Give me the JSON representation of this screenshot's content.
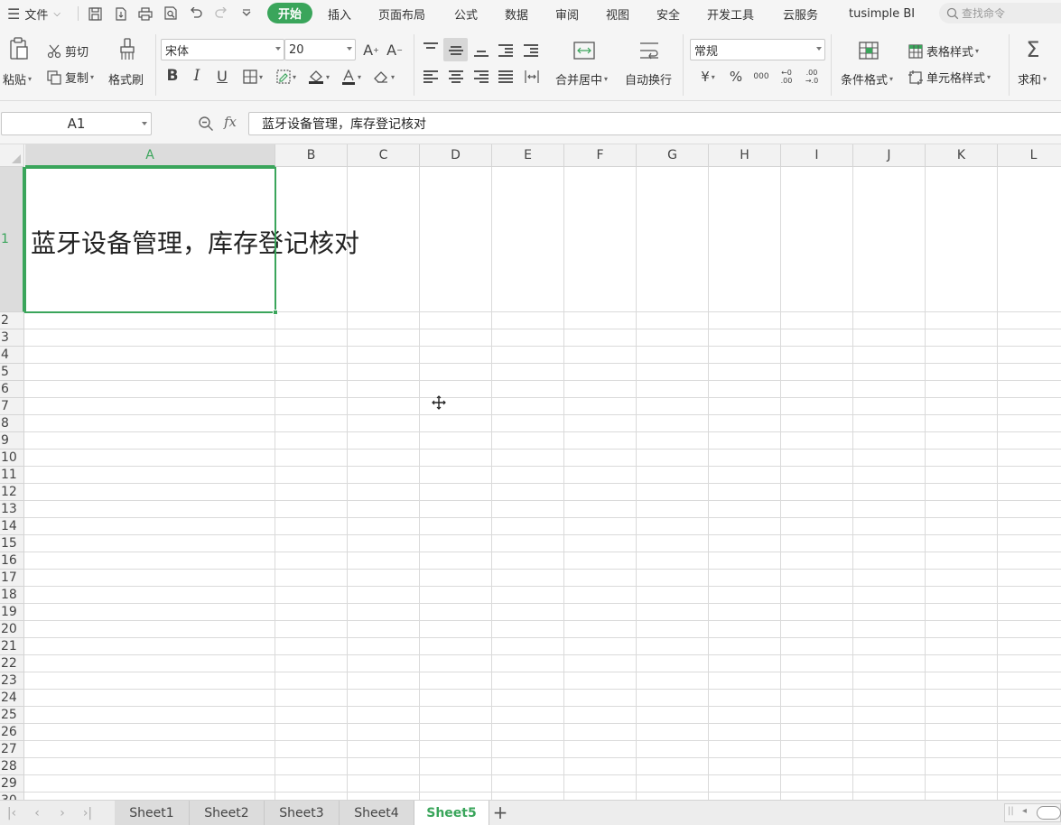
{
  "menubar": {
    "file_label": "文件",
    "tabs": [
      "开始",
      "插入",
      "页面布局",
      "公式",
      "数据",
      "审阅",
      "视图",
      "安全",
      "开发工具",
      "云服务",
      "tusimple BI"
    ],
    "search_placeholder": "查找命令"
  },
  "ribbon": {
    "paste_label": "粘贴",
    "cut_label": "剪切",
    "copy_label": "复制",
    "format_painter_label": "格式刷",
    "font_name": "宋体",
    "font_size": "20",
    "merge_center_label": "合并居中",
    "wrap_text_label": "自动换行",
    "number_format": "常规",
    "conditional_format_label": "条件格式",
    "table_style_label": "表格样式",
    "cell_style_label": "单元格样式",
    "sum_label": "求和"
  },
  "formula_bar": {
    "cell_ref": "A1",
    "fx_label": "fx",
    "content": "蓝牙设备管理，库存登记核对"
  },
  "grid": {
    "columns": [
      "A",
      "B",
      "C",
      "D",
      "E",
      "F",
      "G",
      "H",
      "I",
      "J",
      "K",
      "L"
    ],
    "selected_column": "A",
    "rows": [
      "1",
      "2",
      "3",
      "4",
      "5",
      "6",
      "7",
      "8",
      "9",
      "10",
      "11",
      "12",
      "13",
      "14",
      "15",
      "16",
      "17",
      "18",
      "19",
      "20",
      "21",
      "22",
      "23",
      "24",
      "25",
      "26",
      "27",
      "28",
      "29",
      "30"
    ],
    "selected_row": "1",
    "cell_a1": "蓝牙设备管理，库存登记核对"
  },
  "sheets": {
    "tabs": [
      "Sheet1",
      "Sheet2",
      "Sheet3",
      "Sheet4",
      "Sheet5"
    ],
    "active": "Sheet5"
  },
  "colors": {
    "accent": "#3aa55b",
    "ribbon_bg": "#f5f5f5",
    "grid_line": "#dadada"
  }
}
